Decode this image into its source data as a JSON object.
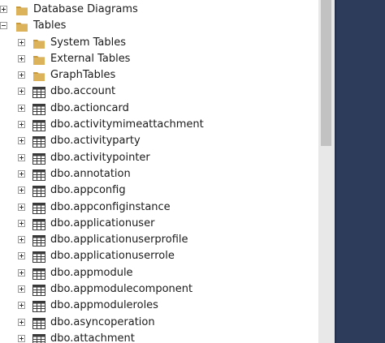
{
  "tree": {
    "items": [
      {
        "label": "Database Diagrams",
        "level": 0,
        "expander": "plus",
        "icon": "folder-icon"
      },
      {
        "label": "Tables",
        "level": 0,
        "expander": "minus",
        "icon": "folder-icon"
      },
      {
        "label": "System Tables",
        "level": 1,
        "expander": "plus",
        "icon": "folder-icon"
      },
      {
        "label": "External Tables",
        "level": 1,
        "expander": "plus",
        "icon": "folder-icon"
      },
      {
        "label": "GraphTables",
        "level": 1,
        "expander": "plus",
        "icon": "folder-icon"
      },
      {
        "label": "dbo.account",
        "level": 1,
        "expander": "plus",
        "icon": "table-icon"
      },
      {
        "label": "dbo.actioncard",
        "level": 1,
        "expander": "plus",
        "icon": "table-icon"
      },
      {
        "label": "dbo.activitymimeattachment",
        "level": 1,
        "expander": "plus",
        "icon": "table-icon"
      },
      {
        "label": "dbo.activityparty",
        "level": 1,
        "expander": "plus",
        "icon": "table-icon"
      },
      {
        "label": "dbo.activitypointer",
        "level": 1,
        "expander": "plus",
        "icon": "table-icon"
      },
      {
        "label": "dbo.annotation",
        "level": 1,
        "expander": "plus",
        "icon": "table-icon"
      },
      {
        "label": "dbo.appconfig",
        "level": 1,
        "expander": "plus",
        "icon": "table-icon"
      },
      {
        "label": "dbo.appconfiginstance",
        "level": 1,
        "expander": "plus",
        "icon": "table-icon"
      },
      {
        "label": "dbo.applicationuser",
        "level": 1,
        "expander": "plus",
        "icon": "table-icon"
      },
      {
        "label": "dbo.applicationuserprofile",
        "level": 1,
        "expander": "plus",
        "icon": "table-icon"
      },
      {
        "label": "dbo.applicationuserrole",
        "level": 1,
        "expander": "plus",
        "icon": "table-icon"
      },
      {
        "label": "dbo.appmodule",
        "level": 1,
        "expander": "plus",
        "icon": "table-icon"
      },
      {
        "label": "dbo.appmodulecomponent",
        "level": 1,
        "expander": "plus",
        "icon": "table-icon"
      },
      {
        "label": "dbo.appmoduleroles",
        "level": 1,
        "expander": "plus",
        "icon": "table-icon"
      },
      {
        "label": "dbo.asyncoperation",
        "level": 1,
        "expander": "plus",
        "icon": "table-icon"
      },
      {
        "label": "dbo.attachment",
        "level": 1,
        "expander": "plus",
        "icon": "table-icon"
      }
    ]
  },
  "colors": {
    "folder": "#dcb25a",
    "folder_tab": "#c99a3c",
    "table_border": "#3a3a3a",
    "dark_panel": "#2e3c5c"
  }
}
